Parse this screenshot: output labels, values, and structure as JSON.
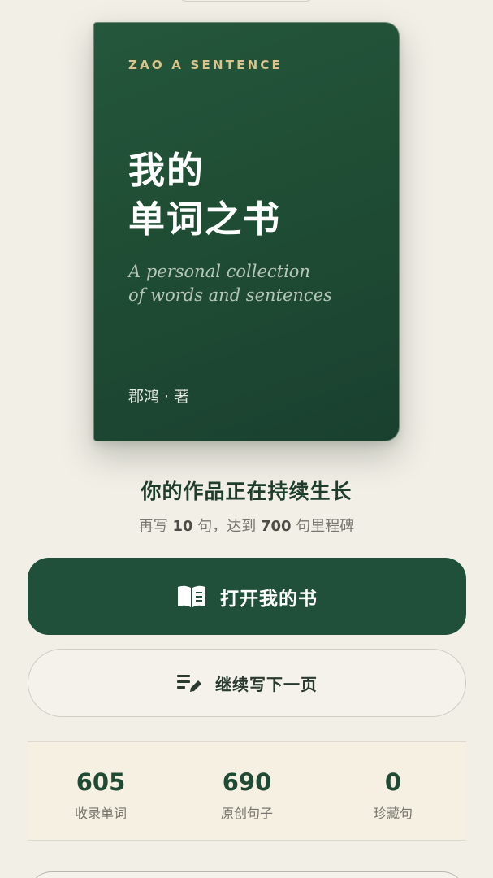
{
  "book": {
    "eyebrow": "ZAO A SENTENCE",
    "title_line1": "我的",
    "title_line2": "单词之书",
    "subtitle_line1": "A personal collection",
    "subtitle_line2": "of words and sentences",
    "author": "郡鸿 · 著"
  },
  "progress": {
    "headline": "你的作品正在持续生长",
    "sub_prefix": "再写 ",
    "sub_remaining": "10",
    "sub_middle": " 句，达到 ",
    "sub_milestone": "700",
    "sub_suffix": " 句里程碑"
  },
  "actions": {
    "open_book_label": "打开我的书",
    "open_book_icon": "book-open-icon",
    "continue_label": "继续写下一页",
    "continue_icon": "edit-lines-icon"
  },
  "stats": [
    {
      "value": "605",
      "label": "收录单词"
    },
    {
      "value": "690",
      "label": "原创句子"
    },
    {
      "value": "0",
      "label": "珍藏句"
    }
  ],
  "colors": {
    "background": "#f1efe6",
    "book_green": "#1f4d34",
    "accent_gold": "#d8c48c",
    "primary_button": "#21503a",
    "stats_background": "#f6f0e3"
  }
}
